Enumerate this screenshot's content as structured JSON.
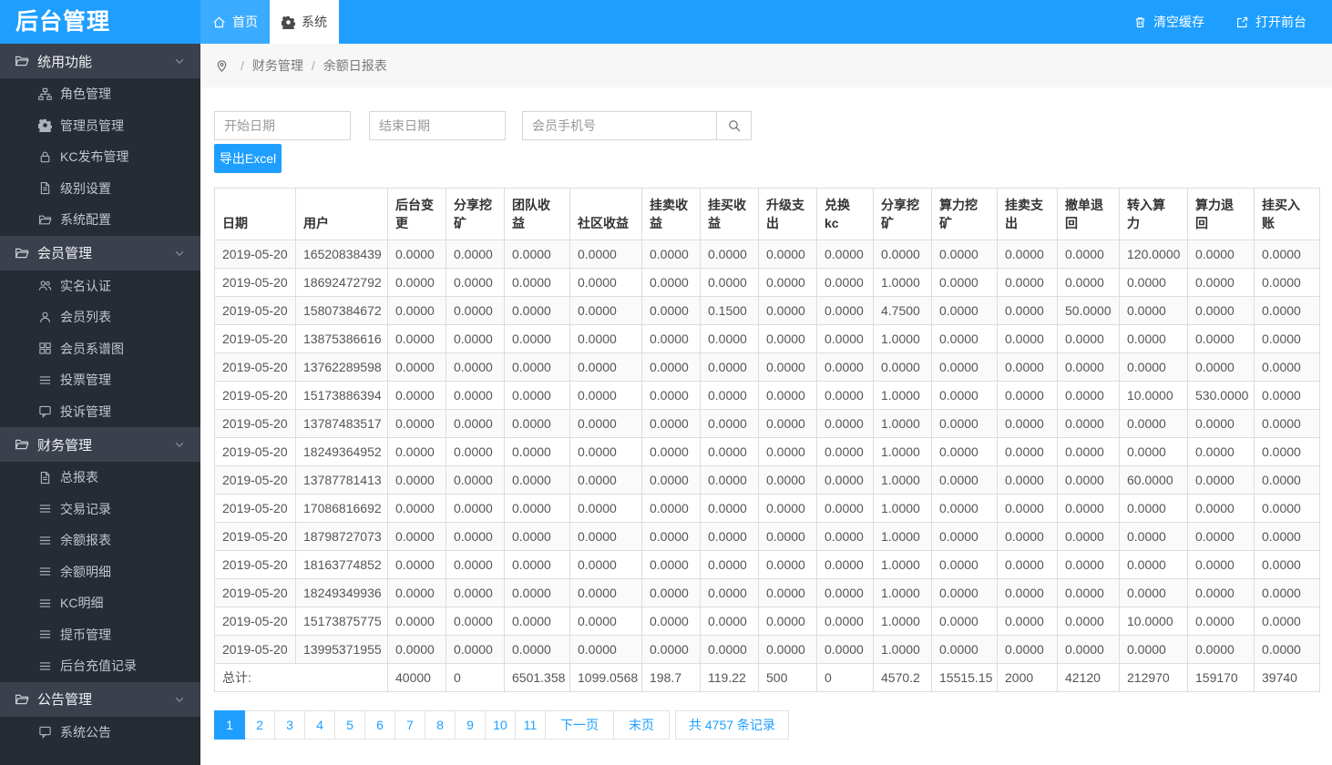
{
  "app": {
    "title": "后台管理"
  },
  "topbar": {
    "tabs": [
      {
        "label": "首页",
        "icon": "home"
      },
      {
        "label": "系统",
        "icon": "gear"
      }
    ],
    "actions": [
      {
        "label": "清空缓存",
        "icon": "trash"
      },
      {
        "label": "打开前台",
        "icon": "external-link"
      }
    ]
  },
  "sidebar": {
    "sections": [
      {
        "label": "统用功能",
        "icon": "folder-open",
        "items": [
          {
            "label": "角色管理",
            "icon": "sitemap"
          },
          {
            "label": "管理员管理",
            "icon": "gear"
          },
          {
            "label": "KC发布管理",
            "icon": "lock"
          },
          {
            "label": "级别设置",
            "icon": "file"
          },
          {
            "label": "系统配置",
            "icon": "folder-open"
          }
        ]
      },
      {
        "label": "会员管理",
        "icon": "folder-open",
        "items": [
          {
            "label": "实名认证",
            "icon": "users"
          },
          {
            "label": "会员列表",
            "icon": "user"
          },
          {
            "label": "会员系谱图",
            "icon": "grid"
          },
          {
            "label": "投票管理",
            "icon": "list"
          },
          {
            "label": "投诉管理",
            "icon": "chat"
          }
        ]
      },
      {
        "label": "财务管理",
        "icon": "folder-open",
        "items": [
          {
            "label": "总报表",
            "icon": "file"
          },
          {
            "label": "交易记录",
            "icon": "list"
          },
          {
            "label": "余额报表",
            "icon": "list"
          },
          {
            "label": "余额明细",
            "icon": "list"
          },
          {
            "label": "KC明细",
            "icon": "list"
          },
          {
            "label": "提币管理",
            "icon": "list"
          },
          {
            "label": "后台充值记录",
            "icon": "list"
          }
        ]
      },
      {
        "label": "公告管理",
        "icon": "folder-open",
        "items": [
          {
            "label": "系统公告",
            "icon": "chat"
          }
        ]
      }
    ]
  },
  "breadcrumb": {
    "items": [
      "财务管理",
      "余额日报表"
    ],
    "separator": "/"
  },
  "filters": {
    "start_date_placeholder": "开始日期",
    "end_date_placeholder": "结束日期",
    "phone_placeholder": "会员手机号",
    "export_label": "导出Excel"
  },
  "table": {
    "columns": [
      "日期",
      "用户",
      "后台变更",
      "分享挖矿",
      "团队收益",
      "社区收益",
      "挂卖收益",
      "挂买收益",
      "升级支出",
      "兑换kc",
      "分享挖矿",
      "算力挖矿",
      "挂卖支出",
      "撤单退回",
      "转入算力",
      "算力退回",
      "挂买入账"
    ],
    "rows": [
      [
        "2019-05-20",
        "16520838439",
        "0.0000",
        "0.0000",
        "0.0000",
        "0.0000",
        "0.0000",
        "0.0000",
        "0.0000",
        "0.0000",
        "0.0000",
        "0.0000",
        "0.0000",
        "0.0000",
        "120.0000",
        "0.0000",
        "0.0000"
      ],
      [
        "2019-05-20",
        "18692472792",
        "0.0000",
        "0.0000",
        "0.0000",
        "0.0000",
        "0.0000",
        "0.0000",
        "0.0000",
        "0.0000",
        "1.0000",
        "0.0000",
        "0.0000",
        "0.0000",
        "0.0000",
        "0.0000",
        "0.0000"
      ],
      [
        "2019-05-20",
        "15807384672",
        "0.0000",
        "0.0000",
        "0.0000",
        "0.0000",
        "0.0000",
        "0.1500",
        "0.0000",
        "0.0000",
        "4.7500",
        "0.0000",
        "0.0000",
        "50.0000",
        "0.0000",
        "0.0000",
        "0.0000"
      ],
      [
        "2019-05-20",
        "13875386616",
        "0.0000",
        "0.0000",
        "0.0000",
        "0.0000",
        "0.0000",
        "0.0000",
        "0.0000",
        "0.0000",
        "1.0000",
        "0.0000",
        "0.0000",
        "0.0000",
        "0.0000",
        "0.0000",
        "0.0000"
      ],
      [
        "2019-05-20",
        "13762289598",
        "0.0000",
        "0.0000",
        "0.0000",
        "0.0000",
        "0.0000",
        "0.0000",
        "0.0000",
        "0.0000",
        "0.0000",
        "0.0000",
        "0.0000",
        "0.0000",
        "0.0000",
        "0.0000",
        "0.0000"
      ],
      [
        "2019-05-20",
        "15173886394",
        "0.0000",
        "0.0000",
        "0.0000",
        "0.0000",
        "0.0000",
        "0.0000",
        "0.0000",
        "0.0000",
        "1.0000",
        "0.0000",
        "0.0000",
        "0.0000",
        "10.0000",
        "530.0000",
        "0.0000"
      ],
      [
        "2019-05-20",
        "13787483517",
        "0.0000",
        "0.0000",
        "0.0000",
        "0.0000",
        "0.0000",
        "0.0000",
        "0.0000",
        "0.0000",
        "1.0000",
        "0.0000",
        "0.0000",
        "0.0000",
        "0.0000",
        "0.0000",
        "0.0000"
      ],
      [
        "2019-05-20",
        "18249364952",
        "0.0000",
        "0.0000",
        "0.0000",
        "0.0000",
        "0.0000",
        "0.0000",
        "0.0000",
        "0.0000",
        "1.0000",
        "0.0000",
        "0.0000",
        "0.0000",
        "0.0000",
        "0.0000",
        "0.0000"
      ],
      [
        "2019-05-20",
        "13787781413",
        "0.0000",
        "0.0000",
        "0.0000",
        "0.0000",
        "0.0000",
        "0.0000",
        "0.0000",
        "0.0000",
        "1.0000",
        "0.0000",
        "0.0000",
        "0.0000",
        "60.0000",
        "0.0000",
        "0.0000"
      ],
      [
        "2019-05-20",
        "17086816692",
        "0.0000",
        "0.0000",
        "0.0000",
        "0.0000",
        "0.0000",
        "0.0000",
        "0.0000",
        "0.0000",
        "1.0000",
        "0.0000",
        "0.0000",
        "0.0000",
        "0.0000",
        "0.0000",
        "0.0000"
      ],
      [
        "2019-05-20",
        "18798727073",
        "0.0000",
        "0.0000",
        "0.0000",
        "0.0000",
        "0.0000",
        "0.0000",
        "0.0000",
        "0.0000",
        "1.0000",
        "0.0000",
        "0.0000",
        "0.0000",
        "0.0000",
        "0.0000",
        "0.0000"
      ],
      [
        "2019-05-20",
        "18163774852",
        "0.0000",
        "0.0000",
        "0.0000",
        "0.0000",
        "0.0000",
        "0.0000",
        "0.0000",
        "0.0000",
        "1.0000",
        "0.0000",
        "0.0000",
        "0.0000",
        "0.0000",
        "0.0000",
        "0.0000"
      ],
      [
        "2019-05-20",
        "18249349936",
        "0.0000",
        "0.0000",
        "0.0000",
        "0.0000",
        "0.0000",
        "0.0000",
        "0.0000",
        "0.0000",
        "1.0000",
        "0.0000",
        "0.0000",
        "0.0000",
        "0.0000",
        "0.0000",
        "0.0000"
      ],
      [
        "2019-05-20",
        "15173875775",
        "0.0000",
        "0.0000",
        "0.0000",
        "0.0000",
        "0.0000",
        "0.0000",
        "0.0000",
        "0.0000",
        "1.0000",
        "0.0000",
        "0.0000",
        "0.0000",
        "10.0000",
        "0.0000",
        "0.0000"
      ],
      [
        "2019-05-20",
        "13995371955",
        "0.0000",
        "0.0000",
        "0.0000",
        "0.0000",
        "0.0000",
        "0.0000",
        "0.0000",
        "0.0000",
        "1.0000",
        "0.0000",
        "0.0000",
        "0.0000",
        "0.0000",
        "0.0000",
        "0.0000"
      ]
    ],
    "total_label": "总计:",
    "totals": [
      "40000",
      "0",
      "6501.358",
      "1099.0568",
      "198.7",
      "119.22",
      "500",
      "0",
      "4570.2",
      "15515.15",
      "2000",
      "42120",
      "212970",
      "159170",
      "39740"
    ]
  },
  "pagination": {
    "pages": [
      "1",
      "2",
      "3",
      "4",
      "5",
      "6",
      "7",
      "8",
      "9",
      "10",
      "11"
    ],
    "active": "1",
    "next_label": "下一页",
    "last_label": "末页",
    "count_label": "共 4757 条记录"
  },
  "colors": {
    "primary": "#1E9FFF",
    "sidebar_bg": "#262B34",
    "sidebar_section_bg": "#3A404C"
  }
}
